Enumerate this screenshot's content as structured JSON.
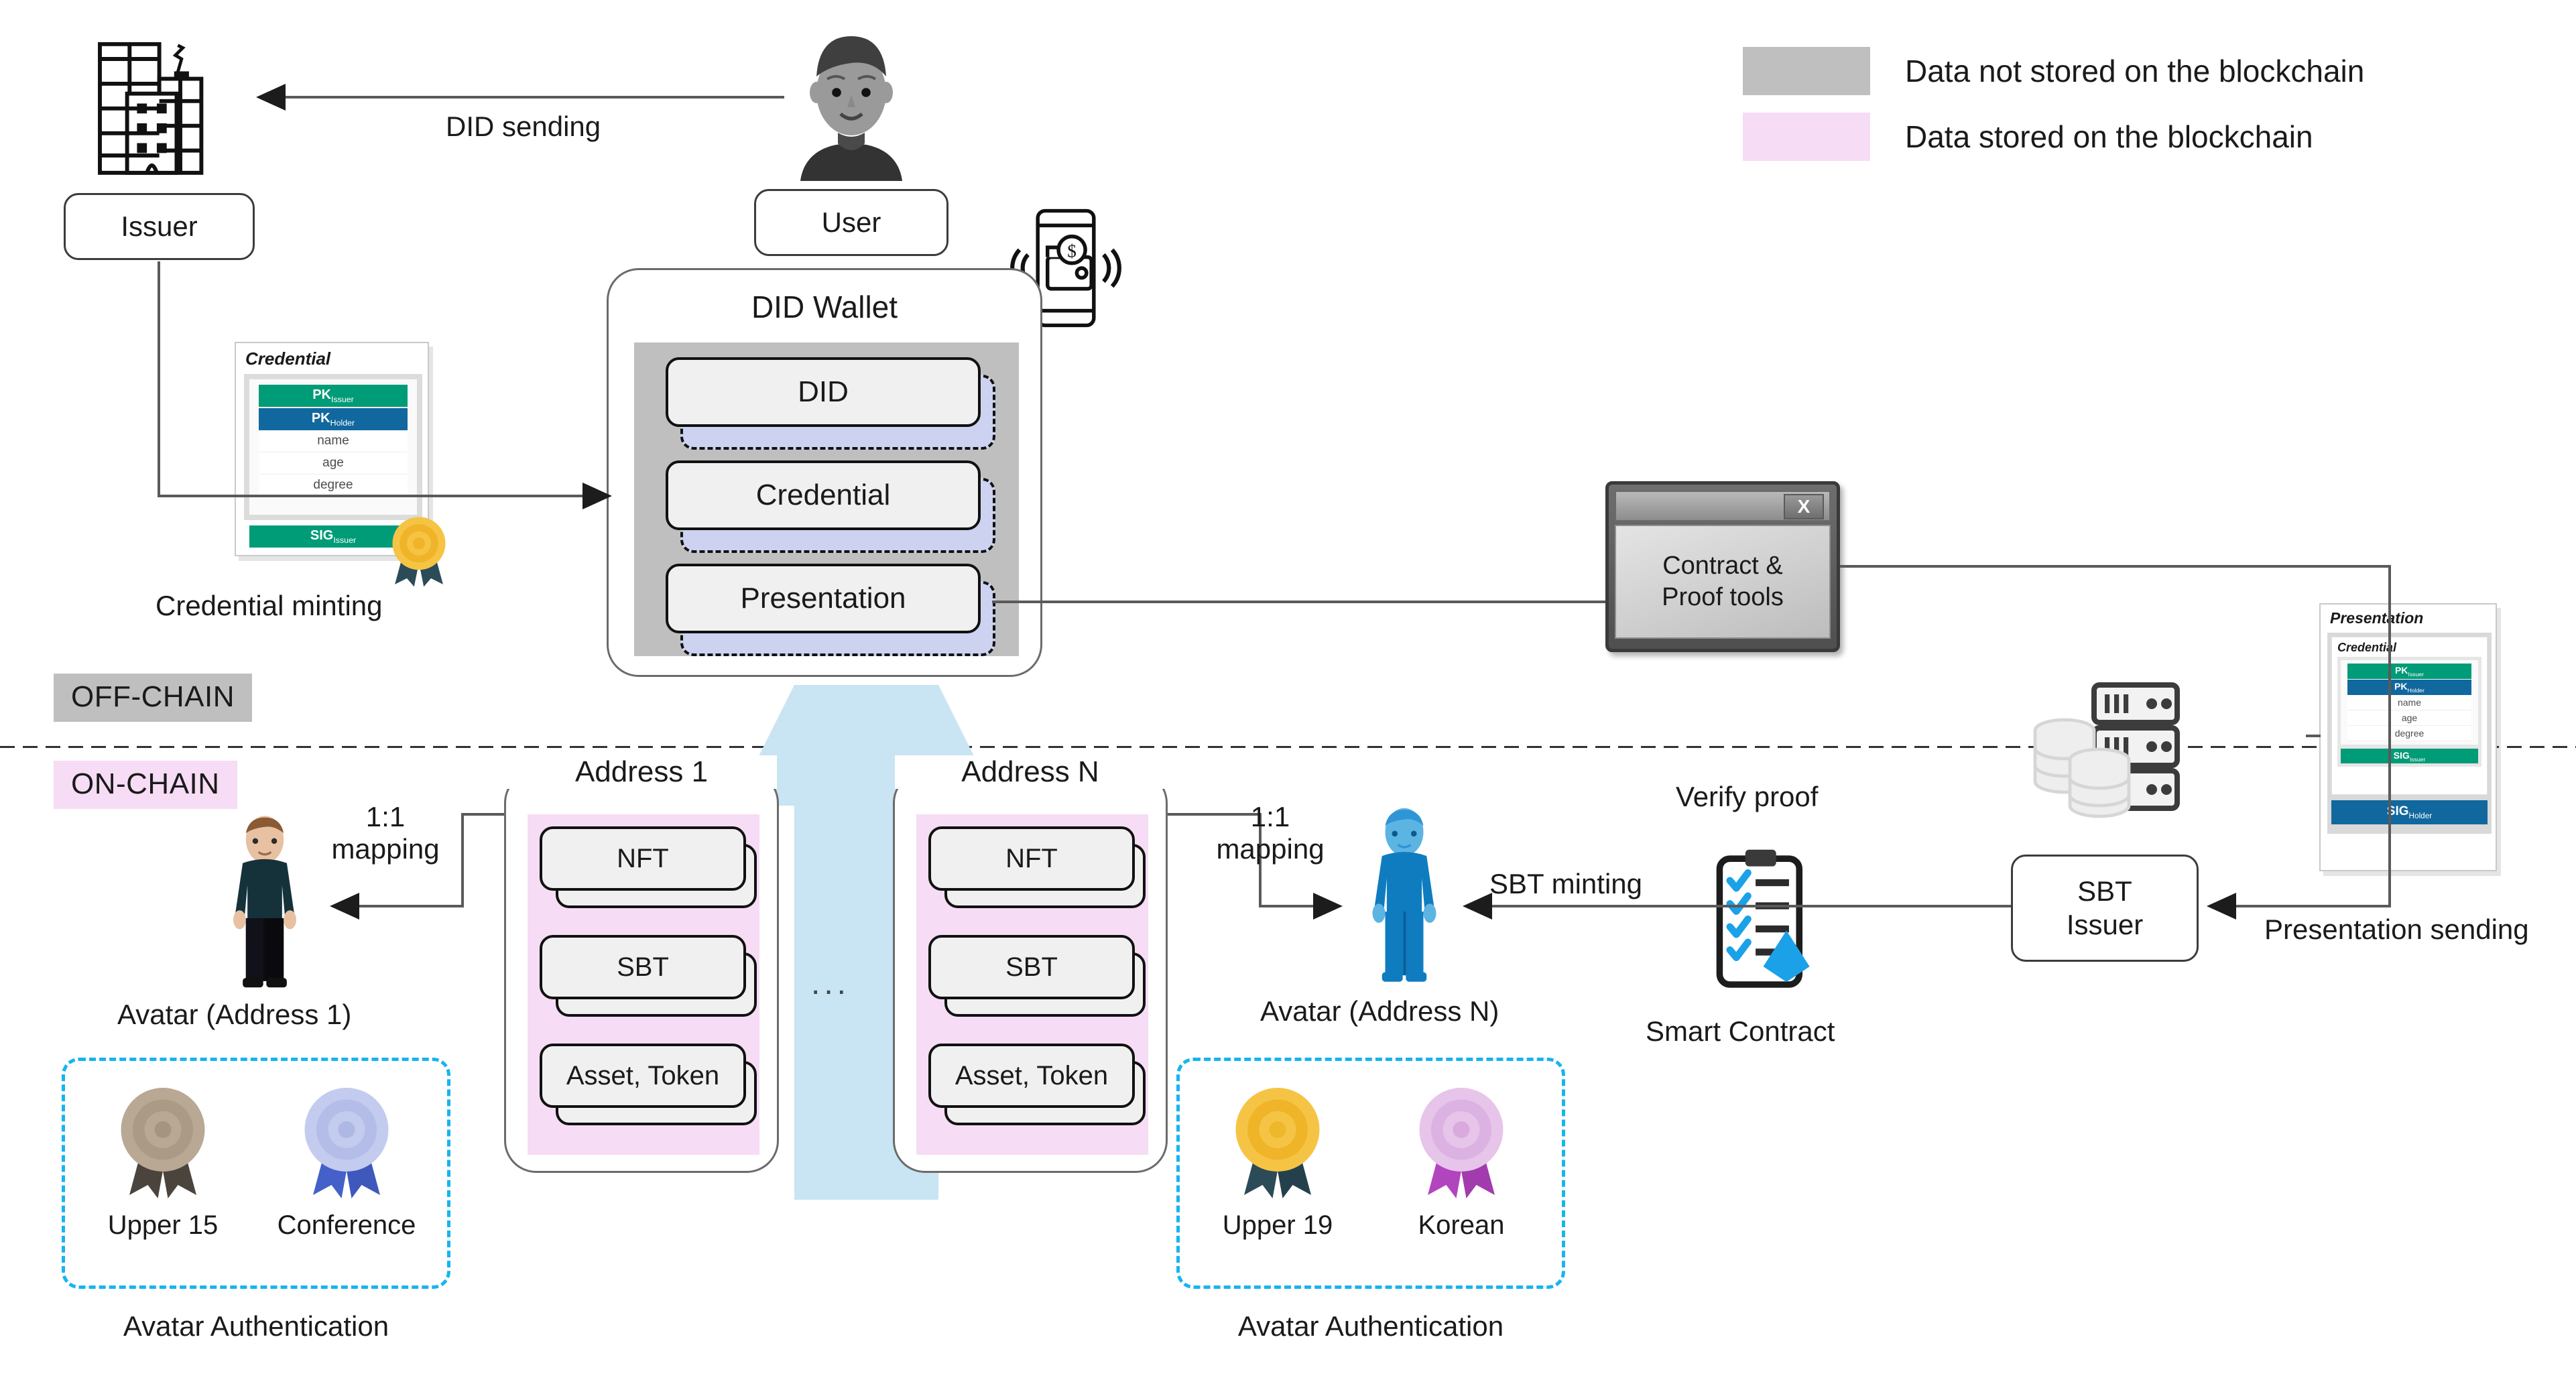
{
  "legend": {
    "items": [
      {
        "label": "Data not stored on the blockchain",
        "color": "#bfbfbf",
        "name": "off-chain"
      },
      {
        "label": "Data stored on the blockchain",
        "color": "#f6dcf4",
        "name": "on-chain"
      }
    ]
  },
  "chain_tags": {
    "off": {
      "label": "OFF-CHAIN",
      "color": "#bfbfbf"
    },
    "on": {
      "label": "ON-CHAIN",
      "color": "#f6dcf4"
    }
  },
  "actors": {
    "issuer": {
      "label": "Issuer",
      "icon": "office-building-icon"
    },
    "user": {
      "label": "User",
      "icon": "user-avatar-icon"
    },
    "phone": {
      "icon": "phone-wallet-nfc-icon"
    },
    "sbt_issuer": {
      "label": "SBT\nIssuer",
      "line1": "SBT",
      "line2": "Issuer"
    },
    "database": {
      "icon": "server-database-icon"
    },
    "smart_contract": {
      "label": "Smart Contract",
      "icon": "clipboard-checklist-ethereum-icon"
    }
  },
  "wallet": {
    "title": "DID Wallet",
    "slots": [
      {
        "label": "DID"
      },
      {
        "label": "Credential"
      },
      {
        "label": "Presentation"
      }
    ]
  },
  "addresses": [
    {
      "title": "Address 1",
      "slots": [
        {
          "label": "NFT"
        },
        {
          "label": "SBT"
        },
        {
          "label": "Asset, Token"
        }
      ]
    },
    {
      "title": "Address N",
      "slots": [
        {
          "label": "NFT"
        },
        {
          "label": "SBT"
        },
        {
          "label": "Asset, Token"
        }
      ]
    }
  ],
  "ellipsis": "...",
  "credential_card": {
    "title": "Credential",
    "bars": [
      {
        "text": "PK",
        "sub": "Issuer",
        "color": "#009b77"
      },
      {
        "text": "PK",
        "sub": "Holder",
        "color": "#11689e"
      }
    ],
    "rows": [
      "name",
      "age",
      "degree"
    ],
    "sig": {
      "text": "SIG",
      "sub": "Issuer",
      "color": "#009b77"
    },
    "seal_icon": "gold-seal-ribbon-icon",
    "caption": "Credential minting"
  },
  "presentation_card": {
    "title": "Presentation",
    "inner_title": "Credential",
    "bars": [
      {
        "text": "PK",
        "sub": "Issuer",
        "color": "#009b77"
      },
      {
        "text": "PK",
        "sub": "Holder",
        "color": "#11689e"
      }
    ],
    "rows": [
      "name",
      "age",
      "degree"
    ],
    "inner_sig": {
      "text": "SIG",
      "sub": "Issuer",
      "color": "#009b77"
    },
    "outer_sig": {
      "text": "SIG",
      "sub": "Holder",
      "color": "#11689e"
    },
    "caption": "Presentation sending"
  },
  "contract_tools": {
    "line1": "Contract &",
    "line2": "Proof tools",
    "close_label": "X"
  },
  "avatars": [
    {
      "caption": "Avatar (Address 1)",
      "color": "#15323b",
      "icon": "avatar-figure-dark-icon"
    },
    {
      "caption": "Avatar (Address N)",
      "color": "#0f7cc0",
      "icon": "avatar-figure-blue-icon"
    }
  ],
  "auth_groups": [
    {
      "caption": "Avatar Authentication",
      "badges": [
        {
          "label": "Upper 15",
          "medal": "#b9a894",
          "ribbon": "#4a443c"
        },
        {
          "label": "Conference",
          "medal": "#c3cbee",
          "ribbon": "#4560c8"
        }
      ]
    },
    {
      "caption": "Avatar Authentication",
      "badges": [
        {
          "label": "Upper 19",
          "medal": "#f6c445",
          "ribbon": "#2c4b59"
        },
        {
          "label": "Korean",
          "medal": "#e7c4ea",
          "ribbon": "#b344bf"
        }
      ]
    }
  ],
  "edges": {
    "did_sending": "DID sending",
    "mapping_1": "1:1\nmapping",
    "mapping_1_l1": "1:1",
    "mapping_1_l2": "mapping",
    "mapping_n_l1": "1:1",
    "mapping_n_l2": "mapping",
    "sbt_minting": "SBT minting",
    "verify_proof": "Verify proof"
  },
  "colors": {
    "teal": "#009b77",
    "blue": "#11689e",
    "pink": "#f6dcf4",
    "gray": "#bfbfbf",
    "cyan_dash": "#17b4f0",
    "funnel": "#c9e4f2"
  }
}
